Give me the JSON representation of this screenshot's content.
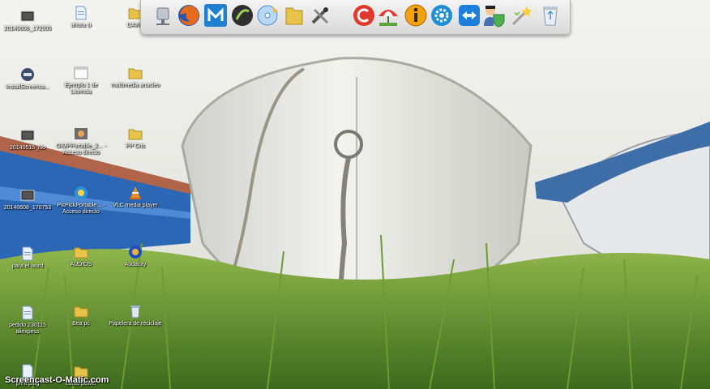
{
  "desktop": {
    "icons": [
      {
        "label": "20140608_172505",
        "icon": "video-file-icon"
      },
      {
        "label": "ahora si",
        "icon": "document-icon"
      },
      {
        "label": "DAVID",
        "icon": "folder-icon"
      },
      {
        "label": "InstallScreenca...",
        "icon": "installer-icon"
      },
      {
        "label": "Ejemplo 1 de Licencia",
        "icon": "document-icon"
      },
      {
        "label": "multimedia anacleo",
        "icon": "folder-icon"
      },
      {
        "label": "20140515_No",
        "icon": "video-file-icon"
      },
      {
        "label": "GIMPPortable_2... - Acceso directo",
        "icon": "gimp-shortcut-icon"
      },
      {
        "label": "PP Cris",
        "icon": "folder-icon"
      },
      {
        "label": "20140608_170753",
        "icon": "video-file-icon"
      },
      {
        "label": "PicPickPortable... - Acceso directo",
        "icon": "picpick-shortcut-icon"
      },
      {
        "label": "VLC media player",
        "icon": "vlc-icon"
      },
      {
        "label": "para el word",
        "icon": "document-icon"
      },
      {
        "label": "AUDIOS",
        "icon": "folder-icon"
      },
      {
        "label": "Audacity",
        "icon": "audacity-icon"
      },
      {
        "label": "pedido 230115 aliexpess",
        "icon": "document-icon"
      },
      {
        "label": "Bea pc",
        "icon": "folder-icon"
      },
      {
        "label": "Papelera de reciclaje",
        "icon": "recycle-bin-icon"
      },
      {
        "label": "print plog",
        "icon": "document-icon"
      },
      {
        "label": "curso power",
        "icon": "folder-icon"
      }
    ]
  },
  "dock": {
    "items": [
      {
        "icon": "network-drive-icon"
      },
      {
        "icon": "firefox-icon"
      },
      {
        "icon": "maxthon-icon"
      },
      {
        "icon": "disc-icon"
      },
      {
        "icon": "cd-burner-icon"
      },
      {
        "icon": "folder-icon"
      },
      {
        "icon": "tools-icon"
      },
      {
        "icon": "ccleaner-icon"
      },
      {
        "icon": "beach-umbrella-icon"
      },
      {
        "icon": "info-icon"
      },
      {
        "icon": "settings-gear-icon"
      },
      {
        "icon": "teamviewer-icon"
      },
      {
        "icon": "user-shield-icon"
      },
      {
        "icon": "wizard-icon"
      },
      {
        "icon": "recycle-bin-icon"
      }
    ]
  },
  "watermark": "Screencast-O-Matic.com",
  "colors": {
    "dock_bg": "#e8e8e8",
    "icon_label": "#ffffff",
    "folder": "#e8c34a",
    "firefox": "#e76b1d",
    "maxthon": "#1f7fd0"
  }
}
